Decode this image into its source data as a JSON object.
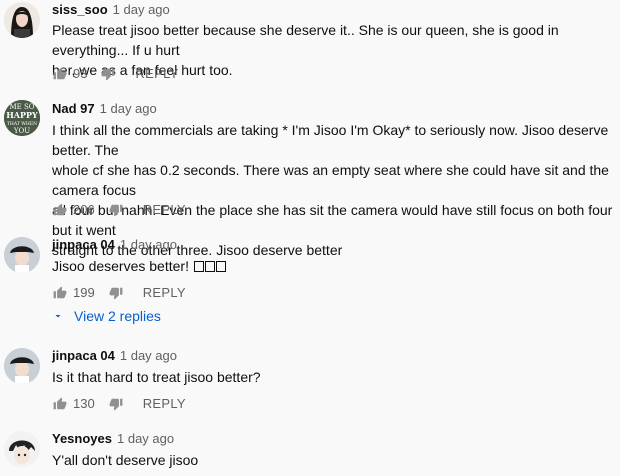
{
  "comments": [
    {
      "author": "siss_soo",
      "time": "1 day ago",
      "text_lines": [
        "Please treat jisoo better because she deserve it.. She is our queen, she is good in everything... If u hurt",
        "her, we as a fan feel hurt too."
      ],
      "likes": "93",
      "reply_label": "REPLY",
      "avatar_icon": "profile-photo-dark-hair"
    },
    {
      "author": "Nad 97",
      "time": "1 day ago",
      "text_lines": [
        "I think all the commercials are taking * I'm Jisoo I'm Okay* to seriously now. Jisoo deserve better. The",
        "whole cf she has 0.2 seconds. There was an empty seat where she could have sit and the camera focus",
        "all four but nahh. Even the place she has sit the camera would have still focus on both four but it went",
        "straight to the other three. Jisoo deserve better"
      ],
      "likes": "206",
      "reply_label": "REPLY",
      "avatar_icon": "happy-text-avatar",
      "avatar_text": [
        "ME SO",
        "HAPPY",
        "THAT WHEN",
        "YOU"
      ]
    },
    {
      "author": "jinpaca 04",
      "time": "1 day ago",
      "text": "Jisoo deserves better!",
      "likes": "199",
      "reply_label": "REPLY",
      "avatar_icon": "profile-photo-bucket-hat",
      "replies_label": "View 2 replies"
    },
    {
      "author": "jinpaca 04",
      "time": "1 day ago",
      "text": "Is it that hard to treat jisoo better?",
      "likes": "130",
      "reply_label": "REPLY",
      "avatar_icon": "profile-photo-bucket-hat"
    },
    {
      "author": "Yesnoyes",
      "time": "1 day ago",
      "text": "Y'all don't deserve jisoo",
      "avatar_icon": "profile-photo-anime"
    }
  ]
}
